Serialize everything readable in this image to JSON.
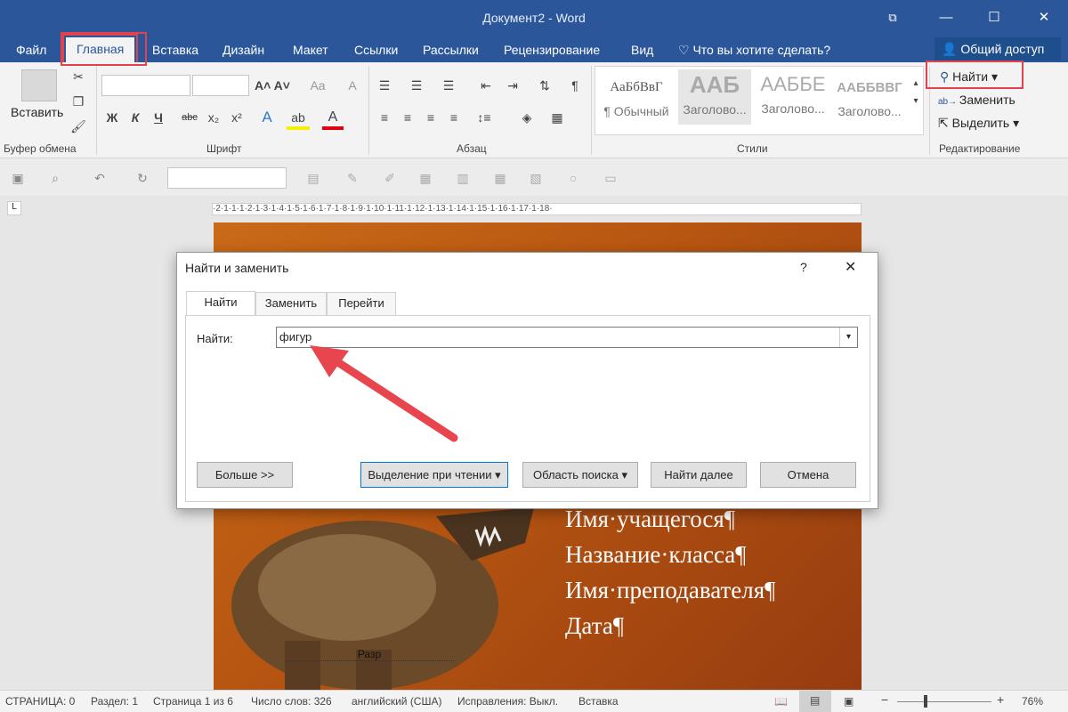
{
  "window": {
    "title": "Документ2 - Word",
    "min": "—",
    "max": "☐",
    "close": "✕",
    "restore": "⧉"
  },
  "tabs": [
    "Файл",
    "Главная",
    "Вставка",
    "Дизайн",
    "Макет",
    "Ссылки",
    "Рассылки",
    "Рецензирование",
    "Вид"
  ],
  "tell_me": "Что вы хотите сделать?",
  "share": "Общий доступ",
  "ribbon": {
    "paste": "Вставить",
    "groups": {
      "clipboard": "Буфер обмена",
      "font": "Шрифт",
      "paragraph": "Абзац",
      "styles": "Стили",
      "editing": "Редактирование"
    },
    "font_buttons": [
      "Ж",
      "К",
      "Ч",
      "abc",
      "x₂",
      "x²"
    ],
    "styles": [
      {
        "sample": "АаБбВвГ",
        "name": "¶ Обычный"
      },
      {
        "sample": "ААБ",
        "name": "Заголово..."
      },
      {
        "sample": "ААББЕ",
        "name": "Заголово..."
      },
      {
        "sample": "ААББВВГ",
        "name": "Заголово..."
      }
    ],
    "find": "Найти",
    "replace": "Заменить",
    "select": "Выделить"
  },
  "ruler_text": "·2·1·1·1·2·1·3·1·4·1·5·1·6·1·7·1·8·1·9·1·10·1·11·1·12·1·13·1·14·1·15·1·16·1·17·1·18·",
  "document": {
    "lines": [
      "Имя·учащегося¶",
      "Название·класса¶",
      "Имя·преподавателя¶",
      "Дата¶"
    ],
    "footer_text": "Разр"
  },
  "dialog": {
    "title": "Найти и заменить",
    "help": "?",
    "tabs": [
      "Найти",
      "Заменить",
      "Перейти"
    ],
    "find_label": "Найти:",
    "find_value": "фигур",
    "buttons": {
      "more": "Больше >>",
      "reading_highlight": "Выделение при чтении ▾",
      "search_in": "Область поиска ▾",
      "find_next": "Найти далее",
      "cancel": "Отмена"
    }
  },
  "status": {
    "page": "СТРАНИЦА: 0",
    "section": "Раздел: 1",
    "page_of": "Страница 1 из 6",
    "words": "Число слов: 326",
    "language": "английский (США)",
    "track": "Исправления: Выкл.",
    "insert": "Вставка",
    "zoom": "76%"
  },
  "colors": {
    "accent": "#2b579a",
    "highlight": "#e0434b",
    "arrow": "#e8464e"
  }
}
